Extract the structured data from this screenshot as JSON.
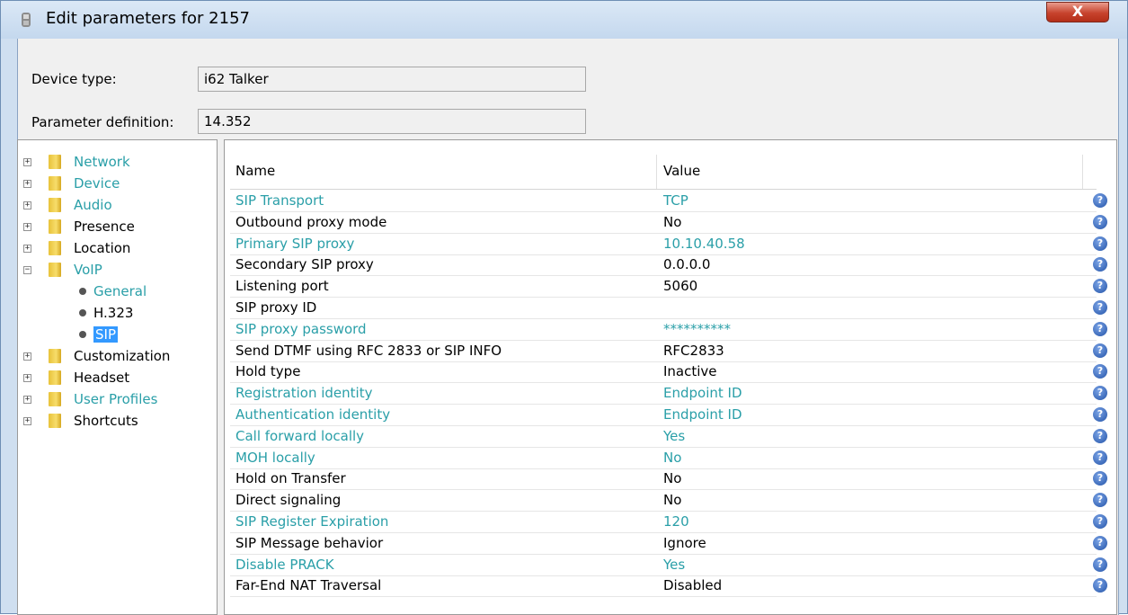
{
  "window": {
    "title": "Edit parameters for 2157",
    "close_label": "X"
  },
  "fields": {
    "device_type_label": "Device type:",
    "device_type_value": "i62 Talker",
    "param_def_label": "Parameter definition:",
    "param_def_value": "14.352"
  },
  "colors": {
    "modified_text": "#2a9fa8",
    "default_text": "#000000",
    "selected_bg": "#3399ff",
    "help_icon": "#2454a8"
  },
  "tree": [
    {
      "label": "Network",
      "modified": true,
      "expanded": false
    },
    {
      "label": "Device",
      "modified": true,
      "expanded": false
    },
    {
      "label": "Audio",
      "modified": true,
      "expanded": false
    },
    {
      "label": "Presence",
      "modified": false,
      "expanded": false
    },
    {
      "label": "Location",
      "modified": false,
      "expanded": false
    },
    {
      "label": "VoIP",
      "modified": true,
      "expanded": true
    },
    {
      "label": "General",
      "modified": true,
      "child": true
    },
    {
      "label": "H.323",
      "modified": false,
      "child": true
    },
    {
      "label": "SIP",
      "modified": true,
      "child": true,
      "selected": true
    },
    {
      "label": "Customization",
      "modified": false,
      "expanded": false
    },
    {
      "label": "Headset",
      "modified": false,
      "expanded": false
    },
    {
      "label": "User Profiles",
      "modified": true,
      "expanded": false
    },
    {
      "label": "Shortcuts",
      "modified": false,
      "expanded": false
    }
  ],
  "table": {
    "columns": [
      "Name",
      "Value"
    ],
    "help_icon": "question-icon",
    "rows": [
      {
        "name": "SIP Transport",
        "value": "TCP",
        "modified": true
      },
      {
        "name": "Outbound proxy mode",
        "value": "No",
        "modified": false
      },
      {
        "name": "Primary SIP proxy",
        "value": "10.10.40.58",
        "modified": true
      },
      {
        "name": "Secondary SIP proxy",
        "value": "0.0.0.0",
        "modified": false
      },
      {
        "name": "Listening port",
        "value": "5060",
        "modified": false
      },
      {
        "name": "SIP proxy ID",
        "value": "",
        "modified": false
      },
      {
        "name": "SIP proxy password",
        "value": "**********",
        "modified": true
      },
      {
        "name": "Send DTMF using RFC 2833 or SIP INFO",
        "value": "RFC2833",
        "modified": false
      },
      {
        "name": "Hold type",
        "value": "Inactive",
        "modified": false
      },
      {
        "name": "Registration identity",
        "value": "Endpoint ID",
        "modified": true
      },
      {
        "name": "Authentication identity",
        "value": "Endpoint ID",
        "modified": true
      },
      {
        "name": "Call forward locally",
        "value": "Yes",
        "modified": true
      },
      {
        "name": "MOH locally",
        "value": "No",
        "modified": true
      },
      {
        "name": "Hold on Transfer",
        "value": "No",
        "modified": false
      },
      {
        "name": "Direct signaling",
        "value": "No",
        "modified": false
      },
      {
        "name": "SIP Register Expiration",
        "value": "120",
        "modified": true
      },
      {
        "name": "SIP Message behavior",
        "value": "Ignore",
        "modified": false
      },
      {
        "name": "Disable PRACK",
        "value": "Yes",
        "modified": true
      },
      {
        "name": "Far-End NAT Traversal",
        "value": "Disabled",
        "modified": false
      }
    ]
  }
}
